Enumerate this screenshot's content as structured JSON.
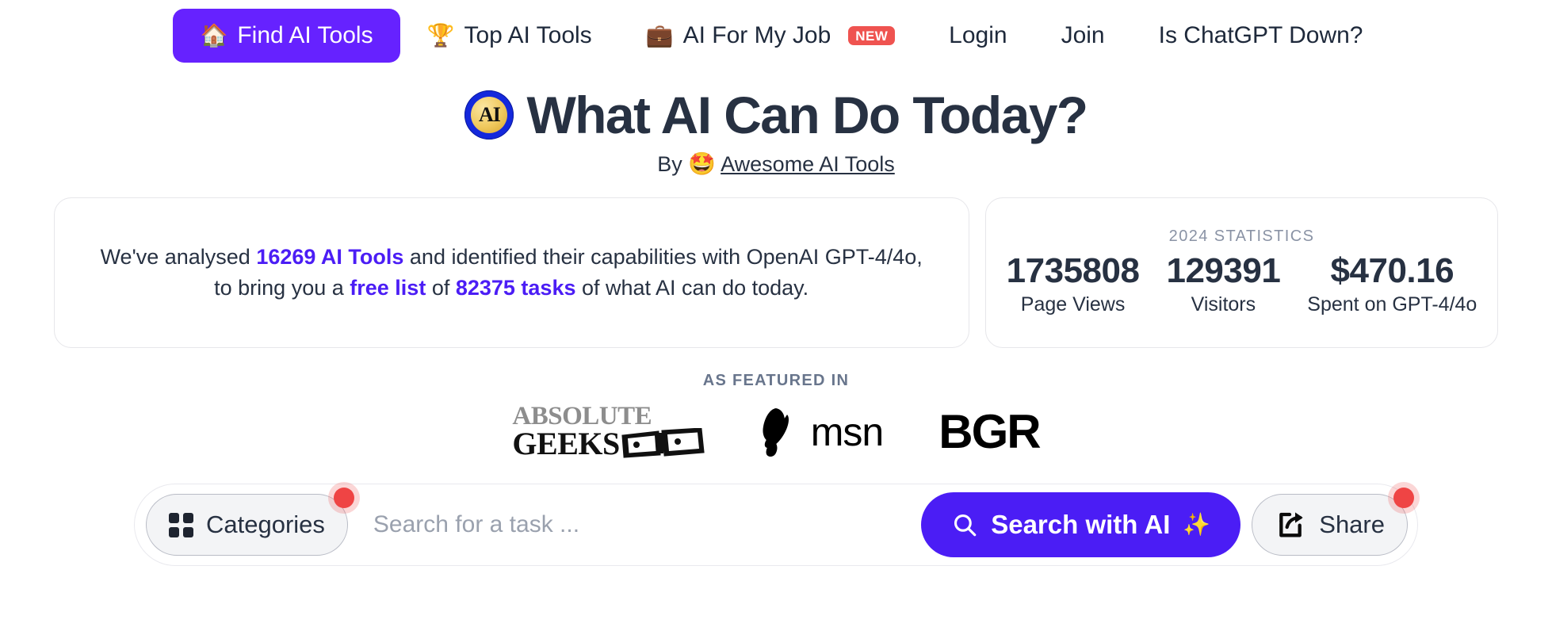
{
  "colors": {
    "accent_purple": "#6622FF",
    "link_purple": "#4B1DF5",
    "badge_red": "#EF5350",
    "notif_red": "#EF4444",
    "text_dark": "#273142",
    "muted_slate": "#68758C"
  },
  "nav": {
    "items": [
      {
        "id": "find-ai-tools",
        "emoji": "🏠",
        "label": "Find AI Tools",
        "active": true,
        "badge": ""
      },
      {
        "id": "top-ai-tools",
        "emoji": "🏆",
        "label": "Top AI Tools",
        "active": false,
        "badge": ""
      },
      {
        "id": "ai-for-my-job",
        "emoji": "💼",
        "label": "AI For My Job",
        "active": false,
        "badge": "NEW"
      },
      {
        "id": "login",
        "emoji": "",
        "label": "Login",
        "active": false,
        "badge": ""
      },
      {
        "id": "join",
        "emoji": "",
        "label": "Join",
        "active": false,
        "badge": ""
      },
      {
        "id": "is-chatgpt-down",
        "emoji": "",
        "label": "Is ChatGPT Down?",
        "active": false,
        "badge": ""
      }
    ]
  },
  "hero": {
    "logo_text": "AI",
    "title": "What AI Can Do Today?",
    "byline_prefix": "By",
    "byline_emoji": "🤩",
    "byline_link": "Awesome AI Tools"
  },
  "analysis_card": {
    "segment_1": "We've analysed ",
    "highlight_1": "16269 AI Tools",
    "segment_2": " and identified their capabilities with OpenAI GPT-4/4o, to bring you a ",
    "highlight_2": "free list",
    "segment_3": " of ",
    "highlight_3": "82375 tasks",
    "segment_4": " of what AI can do today."
  },
  "stats_card": {
    "heading": "2024 STATISTICS",
    "stats": [
      {
        "value": "1735808",
        "label": "Page Views"
      },
      {
        "value": "129391",
        "label": "Visitors"
      },
      {
        "value": "$470.16",
        "label": "Spent on GPT-4/4o"
      }
    ]
  },
  "featured": {
    "heading": "AS FEATURED IN",
    "logos": [
      {
        "id": "absolute-geeks",
        "top": "ABSOLUTE",
        "bottom": "GEEKS"
      },
      {
        "id": "msn",
        "word": "msn"
      },
      {
        "id": "bgr",
        "word": "BGR"
      }
    ]
  },
  "search": {
    "categories_label": "Categories",
    "placeholder": "Search for a task ...",
    "value": "",
    "search_button_label": "Search with AI",
    "sparkle_emoji": "✨",
    "share_label": "Share"
  }
}
